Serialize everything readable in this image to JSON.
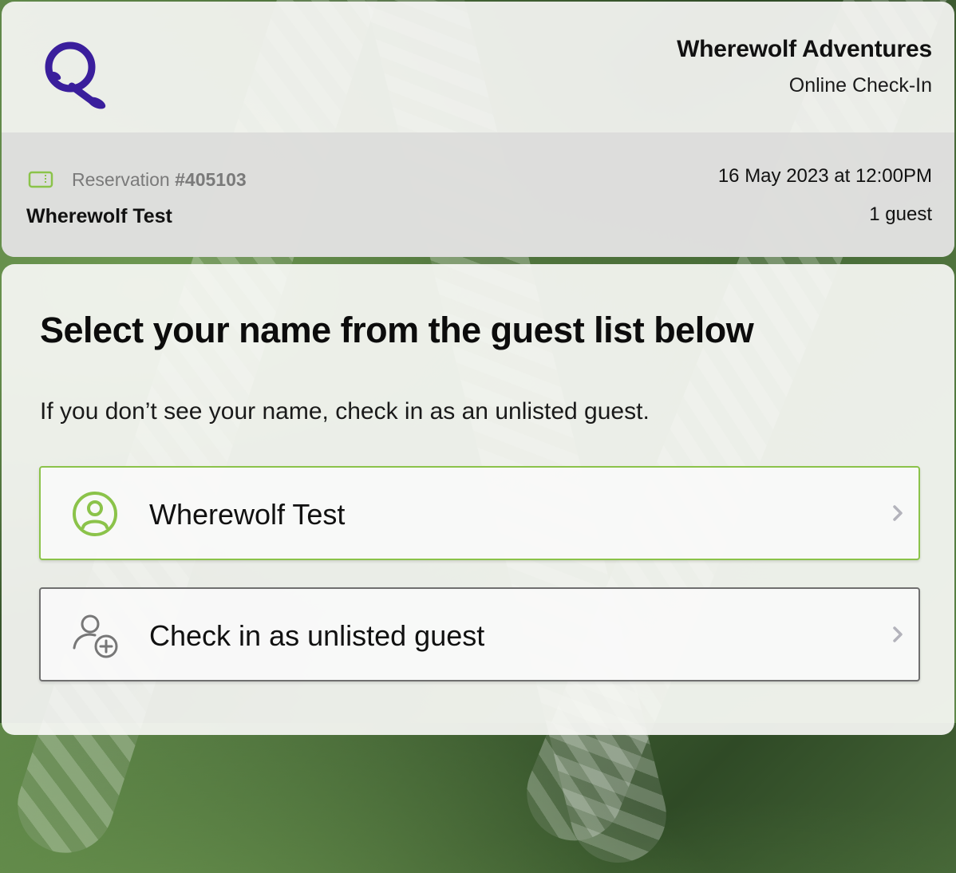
{
  "header": {
    "company_name": "Wherewolf Adventures",
    "subtitle": "Online Check-In",
    "logo": "Q"
  },
  "reservation": {
    "label": "Reservation",
    "number": "#405103",
    "guest_name": "Wherewolf Test",
    "datetime": "16 May 2023 at 12:00PM",
    "guest_count": "1 guest",
    "icon": "ticket-icon"
  },
  "main": {
    "title": "Select your name from the guest list below",
    "subtitle": "If you don’t see your name, check in as an unlisted guest.",
    "options": [
      {
        "label": "Wherewolf Test",
        "icon": "user-circle-icon",
        "accent": "#8bc34a"
      },
      {
        "label": "Check in as unlisted guest",
        "icon": "user-add-icon",
        "accent": "#6f6f6f"
      }
    ]
  },
  "colors": {
    "brand": "#3a1e9c",
    "accent_green": "#8bc34a"
  }
}
